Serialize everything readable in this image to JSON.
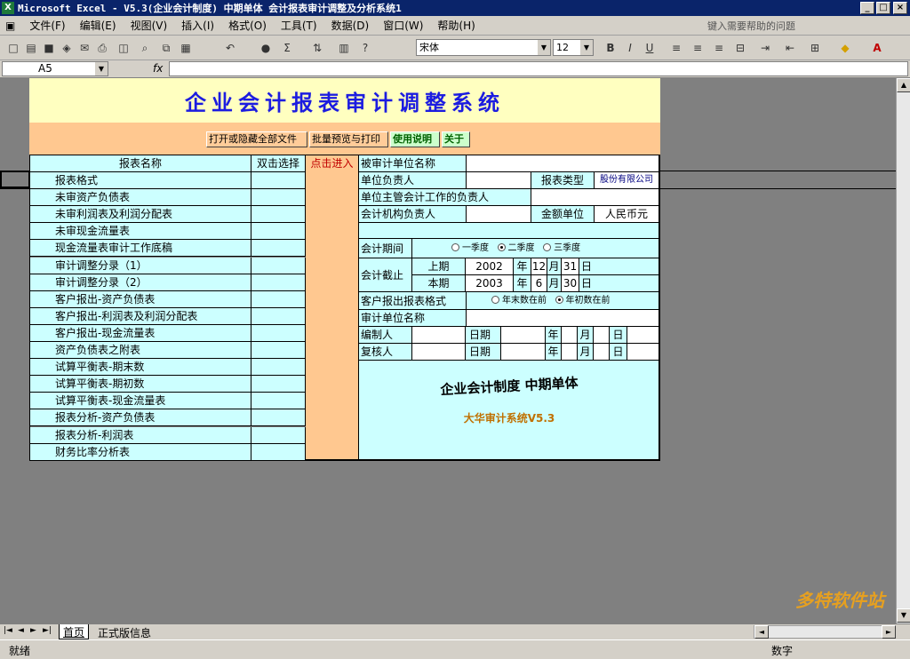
{
  "window": {
    "title": "Microsoft Excel - V5.3(企业会计制度) 中期单体 会计报表审计调整及分析系统1",
    "min": "_",
    "max": "□",
    "close": "×"
  },
  "menu": {
    "items": [
      "文件(F)",
      "编辑(E)",
      "视图(V)",
      "插入(I)",
      "格式(O)",
      "工具(T)",
      "数据(D)",
      "窗口(W)",
      "帮助(H)"
    ],
    "help_placeholder": "键入需要帮助的问题"
  },
  "toolbar": {
    "font_name": "宋体",
    "font_size": "12",
    "bold": "B",
    "italic": "I",
    "underline": "U"
  },
  "formula_bar": {
    "cell_ref": "A5",
    "fx": "fx"
  },
  "sheet": {
    "banner_title": "企业会计报表审计调整系统",
    "buttons": [
      "打开或隐藏全部文件",
      "批量预览与打印",
      "使用说明",
      "关于"
    ],
    "headers": {
      "name": "报表名称",
      "dbl": "双击选择",
      "click": "点击进入"
    },
    "reports": [
      "报表格式",
      "未审资产负债表",
      "未审利润表及利润分配表",
      "未审现金流量表",
      "现金流量表审计工作底稿",
      "审计调整分录（1）",
      "审计调整分录（2）",
      "客户报出-资产负债表",
      "客户报出-利润表及利润分配表",
      "客户报出-现金流量表",
      "资产负债表之附表",
      "试算平衡表-期末数",
      "试算平衡表-期初数",
      "试算平衡表-现金流量表",
      "报表分析-资产负债表",
      "报表分析-利润表",
      "财务比率分析表"
    ],
    "info": {
      "audited_unit": "被审计单位名称",
      "unit_head": "单位负责人",
      "report_type_label": "报表类型",
      "report_type_value": "股份有限公司",
      "supervisor": "单位主管会计工作的负责人",
      "acct_head": "会计机构负责人",
      "amount_unit_label": "金额单位",
      "amount_unit_value": "人民币元",
      "period_label": "会计期间",
      "q1": "一季度",
      "q2": "二季度",
      "q3": "三季度",
      "cutoff_label": "会计截止",
      "prev_label": "上期",
      "prev_year": "2002",
      "prev_month": "12",
      "prev_day": "31",
      "cur_label": "本期",
      "cur_year": "2003",
      "cur_month": "6",
      "cur_day": "30",
      "year_char": "年",
      "month_char": "月",
      "day_char": "日",
      "format_label": "客户报出报表格式",
      "fmt_opt1": "年末数在前",
      "fmt_opt2": "年初数在前",
      "auditor_unit": "审计单位名称",
      "preparer": "编制人",
      "reviewer": "复核人",
      "date_label": "日期",
      "system_title": "企业会计制度  中期单体",
      "system_version": "大华审计系统V5.3"
    }
  },
  "tabs": [
    "首页",
    "正式版信息"
  ],
  "status": {
    "left": "就绪",
    "right": "数字"
  },
  "watermark": "多特软件站",
  "colors": {
    "title_blue": "#1c1ce0",
    "banner_bg": "#ffffc0",
    "orange_bg": "#ffc890",
    "cyan_bg": "#ccffff"
  }
}
